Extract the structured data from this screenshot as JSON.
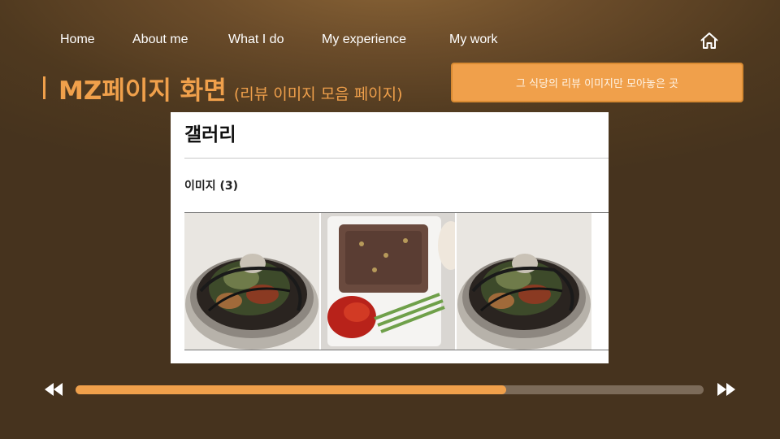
{
  "nav": {
    "items": [
      {
        "label": "Home"
      },
      {
        "label": "About me"
      },
      {
        "label": "What I do"
      },
      {
        "label": "My experience"
      },
      {
        "label": "My work"
      }
    ],
    "home_icon": "home-icon"
  },
  "title": {
    "main": "MZ페이지 화면",
    "sub": "(리뷰 이미지 모음 페이지)"
  },
  "callout": {
    "text": "그 식당의 리뷰 이미지만 모아놓은 곳"
  },
  "screenshot": {
    "heading": "갤러리",
    "image_count": "이미지 (3)",
    "thumbnails": [
      {
        "icon": "naengmyeon-photo"
      },
      {
        "icon": "galbi-plate-photo"
      },
      {
        "icon": "naengmyeon-photo"
      }
    ]
  },
  "player": {
    "progress": 0.685,
    "prev_icon": "rewind-icon",
    "next_icon": "fast-forward-icon"
  },
  "colors": {
    "accent": "#f0a04b",
    "background": "#46331e",
    "track": "#7c6b59"
  }
}
